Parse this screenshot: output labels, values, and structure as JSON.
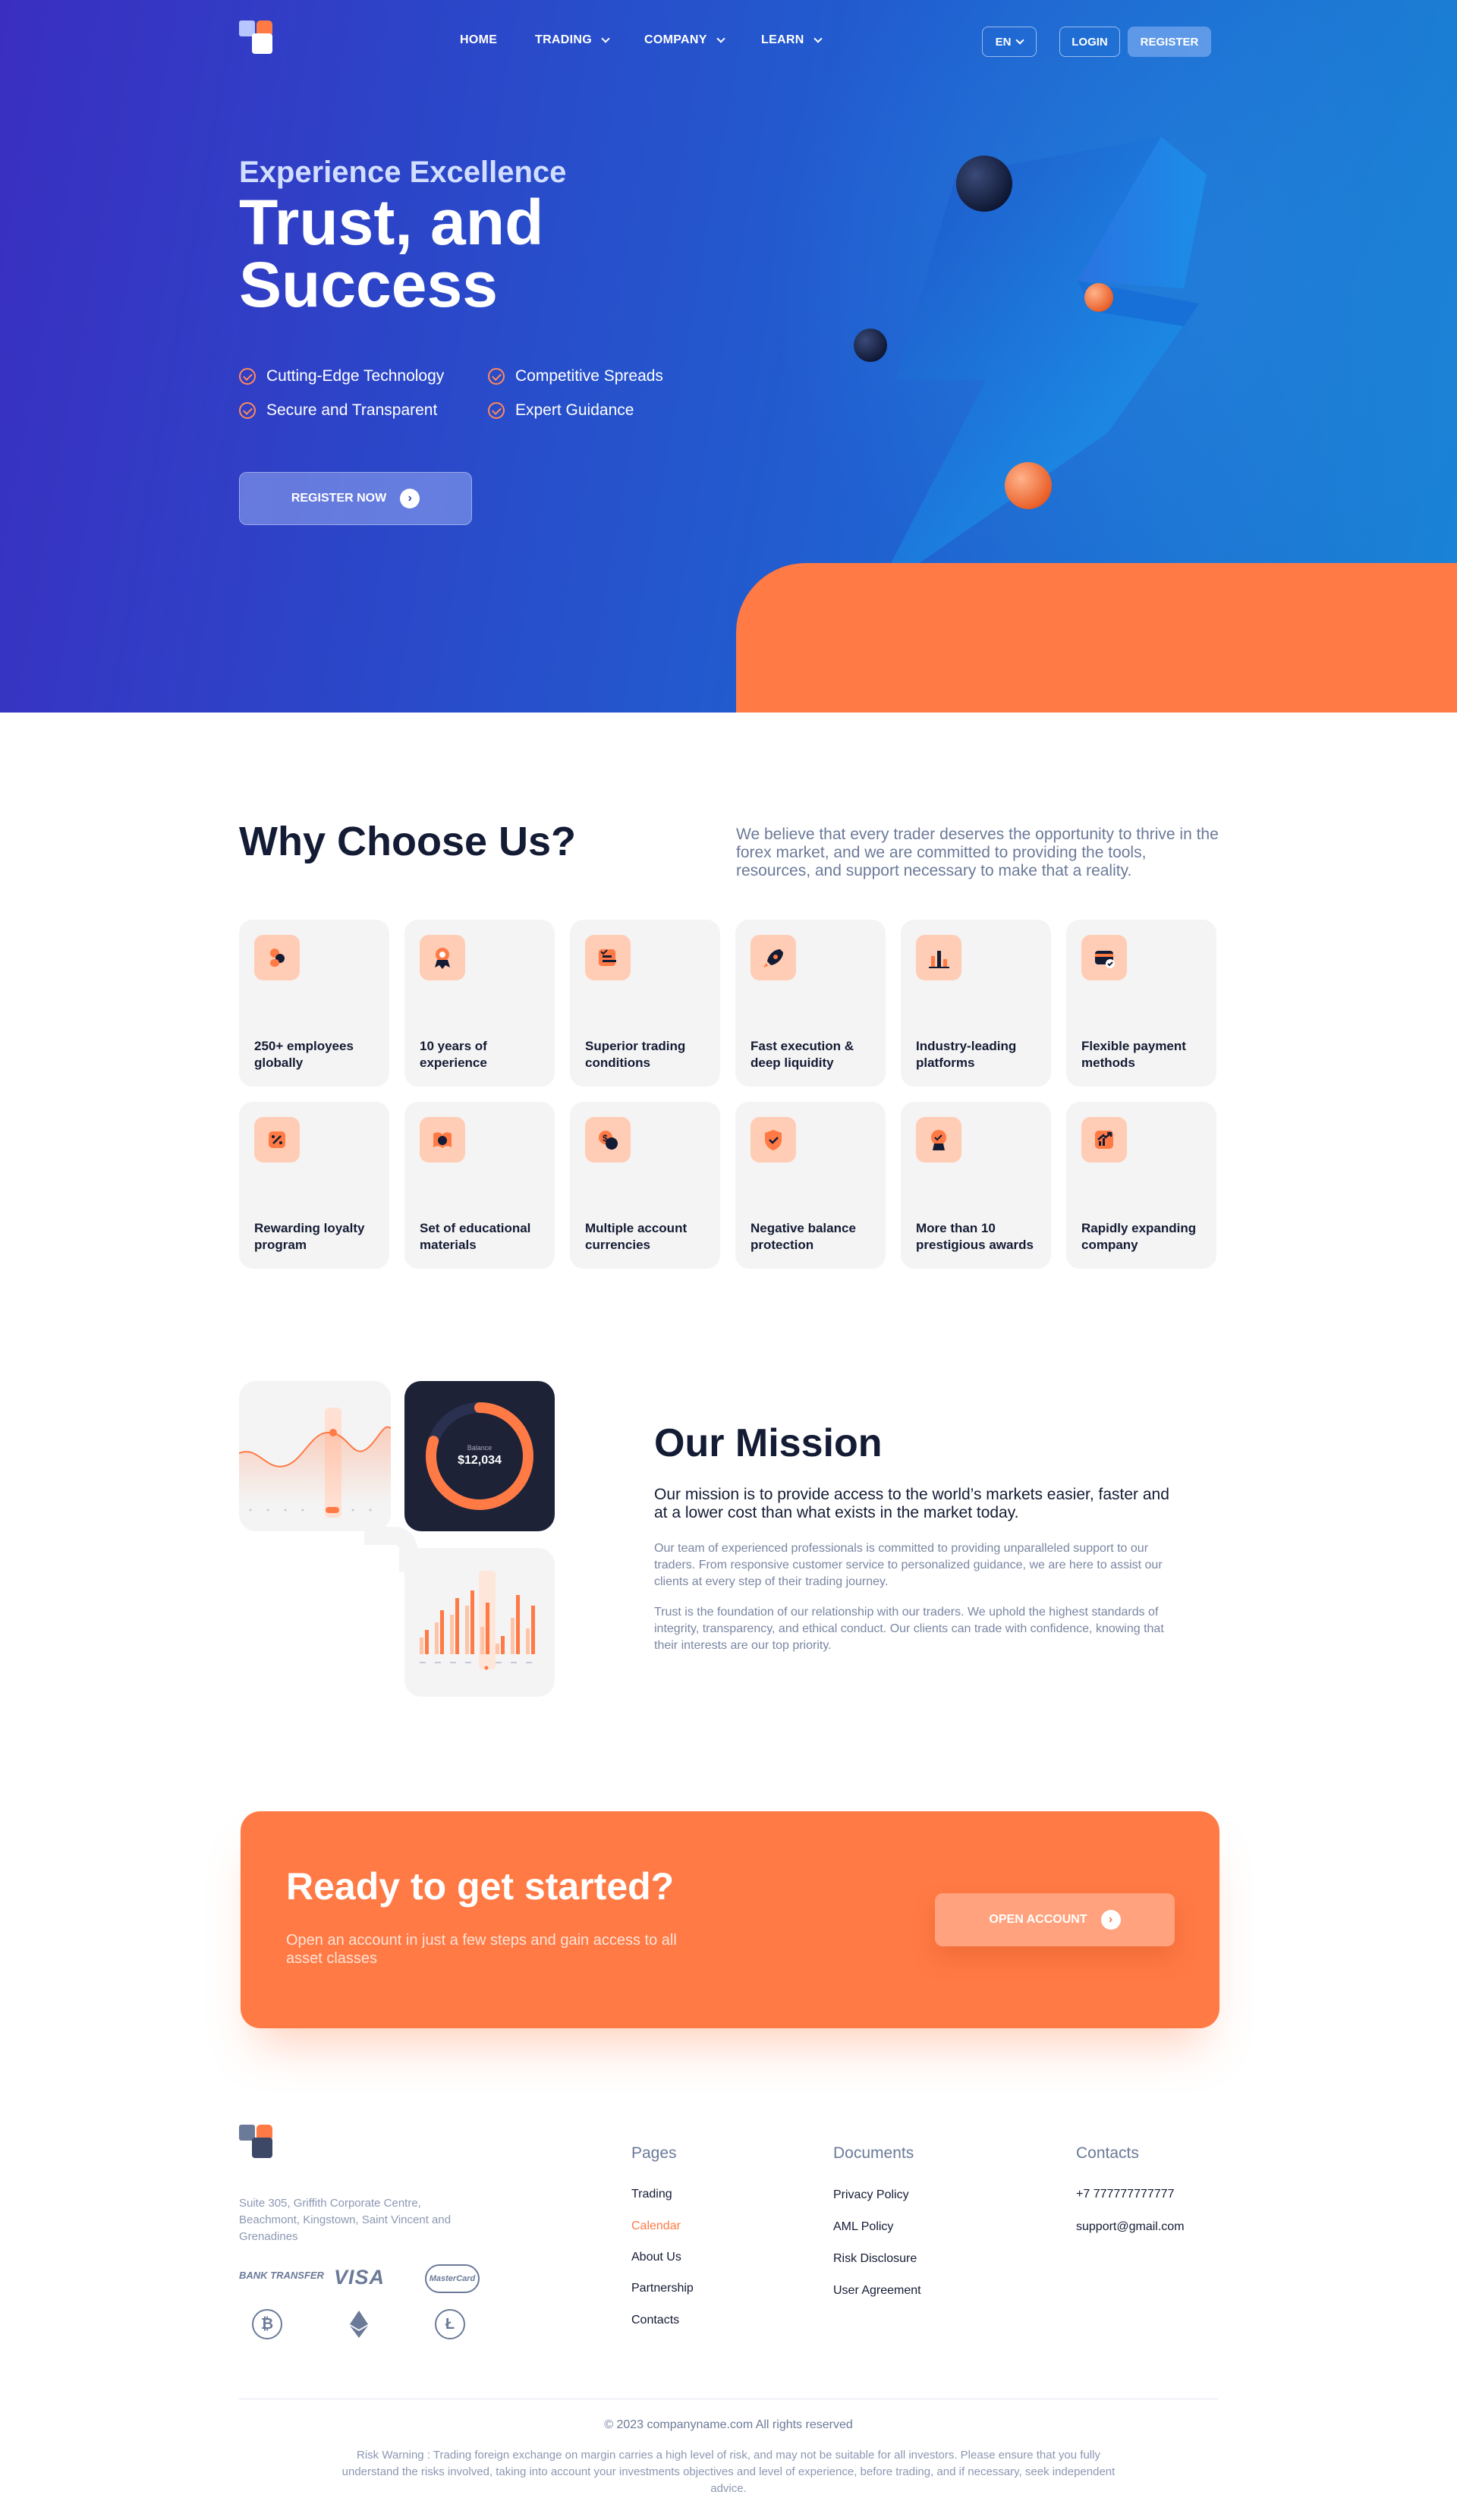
{
  "nav": {
    "items": [
      {
        "label": "HOME",
        "has_dropdown": false
      },
      {
        "label": "TRADING",
        "has_dropdown": true
      },
      {
        "label": "COMPANY",
        "has_dropdown": true
      },
      {
        "label": "LEARN",
        "has_dropdown": true
      }
    ],
    "language": "EN",
    "login_label": "LOGIN",
    "register_label": "REGISTER"
  },
  "hero": {
    "subtitle": "Experience Excellence",
    "title": "Trust, and Success",
    "features": [
      "Cutting-Edge Technology",
      "Competitive Spreads",
      "Secure and Transparent",
      "Expert Guidance"
    ],
    "cta_label": "REGISTER NOW"
  },
  "why": {
    "title": "Why Choose Us?",
    "description": "We believe that every trader deserves the opportunity to thrive in the forex market, and we are committed to providing the tools, resources, and support necessary to make that a reality.",
    "cards": [
      {
        "label": "250+ employees globally",
        "icon": "employees-icon"
      },
      {
        "label": "10 years of experience",
        "icon": "award-icon"
      },
      {
        "label": "Superior trading conditions",
        "icon": "conditions-icon"
      },
      {
        "label": "Fast execution & deep liquidity",
        "icon": "rocket-icon"
      },
      {
        "label": "Industry-leading platforms",
        "icon": "chart-bars-icon"
      },
      {
        "label": "Flexible payment methods",
        "icon": "wallet-icon"
      },
      {
        "label": "Rewarding loyalty program",
        "icon": "percent-icon"
      },
      {
        "label": "Set of educational materials",
        "icon": "book-icon"
      },
      {
        "label": "Multiple account currencies",
        "icon": "currency-icon"
      },
      {
        "label": "Negative balance protection",
        "icon": "shield-icon"
      },
      {
        "label": "More than 10 prestigious awards",
        "icon": "trophy-icon"
      },
      {
        "label": "Rapidly expanding company",
        "icon": "growth-icon"
      }
    ]
  },
  "mission": {
    "title": "Our Mission",
    "lead": "Our mission is to provide access to the world’s markets easier, faster and at a lower cost than what exists in the market today.",
    "paragraphs": [
      "Our team of experienced professionals is committed to providing unparalleled support to our traders. From responsive customer service to personalized guidance, we are here to assist our clients at every step of their trading journey.",
      "Trust is the foundation of our relationship with our traders. We uphold the highest standards of integrity, transparency, and ethical conduct. Our clients can trade with confidence, knowing that their interests are our top priority."
    ],
    "widget": {
      "balance_label": "Balance",
      "balance_value": "$12,034",
      "balance_progress": 0.8
    }
  },
  "cta": {
    "title": "Ready to get started?",
    "subtitle": "Open an account in just a few steps and gain access to all asset classes",
    "button_label": "OPEN ACCOUNT"
  },
  "footer": {
    "address": "Suite 305, Griffith Corporate Centre, Beachmont, Kingstown, Saint Vincent and Grenadines",
    "payments": [
      "BANK TRANSFER",
      "VISA",
      "MasterCard"
    ],
    "crypto": [
      "bitcoin-icon",
      "ethereum-icon",
      "litecoin-icon"
    ],
    "pages": {
      "heading": "Pages",
      "links": [
        "Trading",
        "Calendar",
        "About Us",
        "Partnership",
        "Contacts"
      ],
      "active_index": 1
    },
    "documents": {
      "heading": "Documents",
      "links": [
        "Privacy Policy",
        "AML Policy",
        "Risk Disclosure",
        "User Agreement"
      ]
    },
    "contacts": {
      "heading": "Contacts",
      "phone": "+7 777777777777",
      "email": "support@gmail.com"
    },
    "copyright": "© 2023 companyname.com All rights reserved",
    "risk_warning": "Risk Warning : Trading foreign exchange on margin carries a high level of risk, and may not be suitable for all investors. Please ensure that you fully understand the risks involved, taking into account your investments objectives and level of experience, before trading, and if necessary, seek independent advice."
  },
  "colors": {
    "accent": "#ff7a45",
    "brand_blue": "#2b47c9",
    "dark": "#141b34"
  }
}
